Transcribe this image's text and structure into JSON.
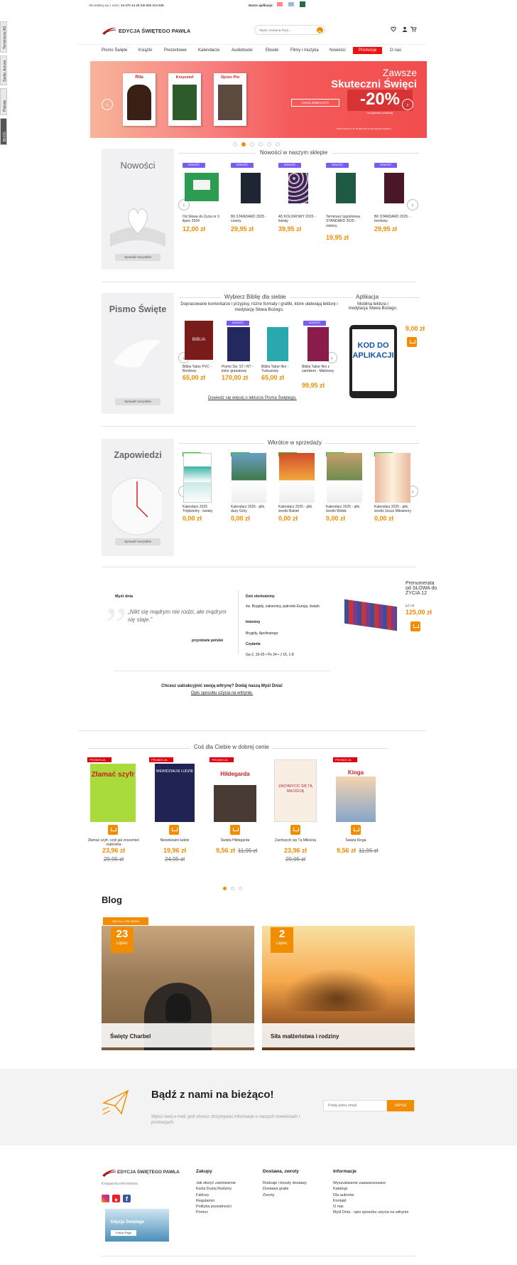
{
  "topbar": {
    "phone_label": "Skontaktuj się z nami:",
    "phone_numbers": "34 370 34 29 lub 605 313 945",
    "app_label": "Nasze aplikacje:"
  },
  "search": {
    "placeholder": "Wpisz szukaną frazę..."
  },
  "logo": {
    "text": "EDYCJA ŚWIĘTEGO PAWŁA",
    "subtitle": "Księgarnia internetowa"
  },
  "nav": [
    "Pismo Święte",
    "Książki",
    "Prezentowe",
    "Kalendarze",
    "Audiobooki",
    "Ebooki",
    "Filmy i muzyka",
    "Nowości",
    "Promocje",
    "O nas"
  ],
  "side_tabs": [
    "Terminarze AS",
    "Santo Jezusa",
    "Plakaty",
    "BLOG"
  ],
  "banner": {
    "line1": "Zawsze",
    "line2": "Skuteczni Święci",
    "percent": "-20%",
    "note": "na wybrane produkty",
    "cta": "CHCĘ ZOBACZYĆ",
    "footnote": "Oferta ważna do 31.10.2024 lub do wyczerpania zapasów",
    "book_names": [
      "Rita",
      "Krzysztof",
      "Ojciec Pio"
    ]
  },
  "new_section": {
    "side_title": "Nowości",
    "heading": "Nowości w naszym sklepie",
    "see_all": "Sprawdź wszystkie",
    "badge": "NOWOŚĆ",
    "items": [
      {
        "name": "Od Słowa do Życia nr 3 lipiec 2024",
        "price": "12,00 zł"
      },
      {
        "name": "B6 STANDARD 2025 - czarny",
        "price": "29,95 zł"
      },
      {
        "name": "A5 KOLOROWY 2025 - kwiaty",
        "price": "39,95 zł"
      },
      {
        "name": "Terminarz tygodniowy STANDARD 2025 - zielony",
        "price": "19,95 zł"
      },
      {
        "name": "B6 STANDARD 2025 - bordowy",
        "price": "29,95 zł"
      }
    ]
  },
  "bible_section": {
    "side_title": "Pismo Święte",
    "heading": "Wybierz Biblię dla siebie",
    "desc": "Dopracowane komentarze i przypisy, różne formaty i grafiki, które ułatwiają lekturę i medytację Słowa Bożego.",
    "link": "Dowiedz się więcej o lekturze Pisma Świętego.",
    "see_all": "Sprawdź wszystkie",
    "badge": "NOWOŚĆ",
    "cover_text": "BIBLIA",
    "items": [
      {
        "name": "Biblia Tabor PVC - Bordowy",
        "price": "65,00 zł"
      },
      {
        "name": "Pismo Św. ST i NT - kolor granatowy",
        "price": "170,00 zł"
      },
      {
        "name": "Biblia Tabor flex - Turkusowy",
        "price": "65,00 zł"
      },
      {
        "name": "Biblia Tabor flex z zamkiem - Malinowy",
        "price": "99,95 zł"
      }
    ],
    "app_title": "Aplikacja",
    "app_desc": "Mobilna lektura i medytacja Słowa Bożego.",
    "app_price": "9,00 zł",
    "app_code": "KOD DO APLIKACJI"
  },
  "upcoming_section": {
    "side_title": "Zapowiedzi",
    "heading": "Wkrótce w sprzedaży",
    "see_all": "Sprawdź wszystkie",
    "badge": "ZAPOWIEDŹ",
    "items": [
      {
        "name": "Kalendarz 2025 Trójdzielny - kwiaty",
        "price": "0,00 zł"
      },
      {
        "name": "Kalendarz 2025 - plik. duży Góry",
        "price": "0,00 zł"
      },
      {
        "name": "Kalendarz 2025 - plik. średni Bukiet",
        "price": "0,00 zł"
      },
      {
        "name": "Kalendarz 2025 - plik. średni Widok",
        "price": "0,00 zł"
      },
      {
        "name": "Kalendarz 2025 - plik. średni Jezus Miłosierny",
        "price": "0,00 zł"
      }
    ]
  },
  "thought": {
    "title": "Myśl dnia",
    "quote": "„Nikt się mądrym nie rodzi, ale mądrym się staje.”",
    "author": "przysłowie polskie",
    "today_title": "Dziś obchodzimy",
    "today_text": "św. Brygidy, zakonnicy, patronki Europy, święto",
    "names_title": "Imieniny",
    "names_text": "Brygidy, Apolinarego",
    "readings_title": "Czytania",
    "readings_text": "Ga 2, 19-20 • Ps 34 • J 15, 1-8",
    "subscription": "Prenumerata od SŁOWA do ŻYCIA 12",
    "sub_from": "już od",
    "sub_price": "125,00 zł",
    "widget_q": "Chcesz uatrakcyjnić swoją witrynę? Dodaj naszą Myśl Dnia!",
    "widget_link": "Opis sposobu użycia na witrynie."
  },
  "deals": {
    "heading": "Coś dla Ciebie w dobrej cenie",
    "badge": "PROMOCJA",
    "items": [
      {
        "name": "Złamać szyfr, czyli jak zrozumieć małżonka",
        "price": "23,96 zł",
        "old": "29,95 zł",
        "cover": "Złamać szyfr"
      },
      {
        "name": "Niewidzialni ludzie",
        "price": "19,96 zł",
        "old": "24,95 zł",
        "cover": "NIEWIDZIALNI LUDZIE"
      },
      {
        "name": "Święta Hildegarda",
        "price": "9,56 zł",
        "old": "11,95 zł",
        "cover": "Hildegarda"
      },
      {
        "name": "Zachwycić się Tą Miłością",
        "price": "23,96 zł",
        "old": "29,95 zł",
        "cover": "ZACHWYCIĆ SIĘ TĄ MIŁOŚCIĄ"
      },
      {
        "name": "Święta Kinga",
        "price": "9,56 zł",
        "old": "11,95 zł",
        "cover": "Kinga"
      }
    ]
  },
  "blog": {
    "heading": "Blog",
    "see_all": "SEE ALL THE NEWS",
    "posts": [
      {
        "day": "23",
        "month": "Lipiec",
        "title": "Święty Charbel"
      },
      {
        "day": "2",
        "month": "Lipiec",
        "title": "Siła małżeństwa i rodziny"
      }
    ]
  },
  "newsletter": {
    "heading": "Bądź z nami na bieżąco!",
    "text": "Wpisz swój e-mail, jeśli chcesz otrzymywać informacje o naszych nowościach i promocjach.",
    "placeholder": "Podaj adres email",
    "button": "ZAPISZ"
  },
  "footer": {
    "fb_title": "Edycja Świętego",
    "fb_follow": "Follow Page",
    "cols": [
      {
        "title": "Zakupy",
        "links": [
          "Jak złożyć zamówienie",
          "Karta Dużej Rodziny",
          "Faktury",
          "Regulamin",
          "Polityka prywatności",
          "Pomoc"
        ]
      },
      {
        "title": "Dostawa, zwroty",
        "links": [
          "Rodzaje i koszty dostawy",
          "Dostawa gratis",
          "Zwroty"
        ]
      },
      {
        "title": "Informacje",
        "links": [
          "Wyszukiwanie zaawansowane",
          "Katalogi",
          "Dla autorów",
          "Kontakt",
          "O nas",
          "Myśl Dnia - opis sposobu użycia na witrynie"
        ]
      }
    ]
  },
  "colors": {
    "accent": "#f28c00",
    "promo": "#dd1111",
    "new": "#7a5cf5",
    "upcoming": "#22bb22",
    "banner": "#f55a5a"
  }
}
